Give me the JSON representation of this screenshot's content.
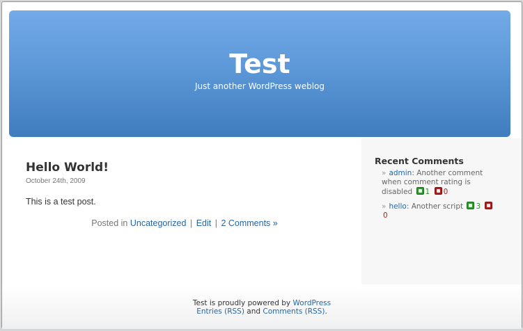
{
  "header": {
    "blog_title": "Test",
    "blog_description": "Just another WordPress weblog"
  },
  "post": {
    "title": "Hello World!",
    "date": "October 24th, 2009",
    "body": "This is a test post.",
    "posted_in_prefix": "Posted in",
    "category": "Uncategorized",
    "separator": "|",
    "edit_label": "Edit",
    "comments_label": "2 Comments »"
  },
  "sidebar": {
    "heading": "Recent Comments",
    "bullet": "»",
    "comments": [
      {
        "author": "admin",
        "text": ": Another comment when comment rating is disabled",
        "up_count": "1",
        "down_count": "0"
      },
      {
        "author": "hello",
        "text": ": Another script",
        "up_count": "3",
        "down_count": "0"
      }
    ]
  },
  "footer": {
    "line1_prefix": "Test is proudly powered by",
    "wordpress_link": "WordPress",
    "entries_rss": "Entries (RSS)",
    "and_text": "and",
    "comments_rss": "Comments (RSS)",
    "period": "."
  },
  "colors": {
    "header_gradient_top": "#73aae8",
    "header_gradient_bottom": "#3f7dbe",
    "link": "#2266aa",
    "rate_up": "#2e9a2e",
    "rate_down": "#b01f1f"
  }
}
